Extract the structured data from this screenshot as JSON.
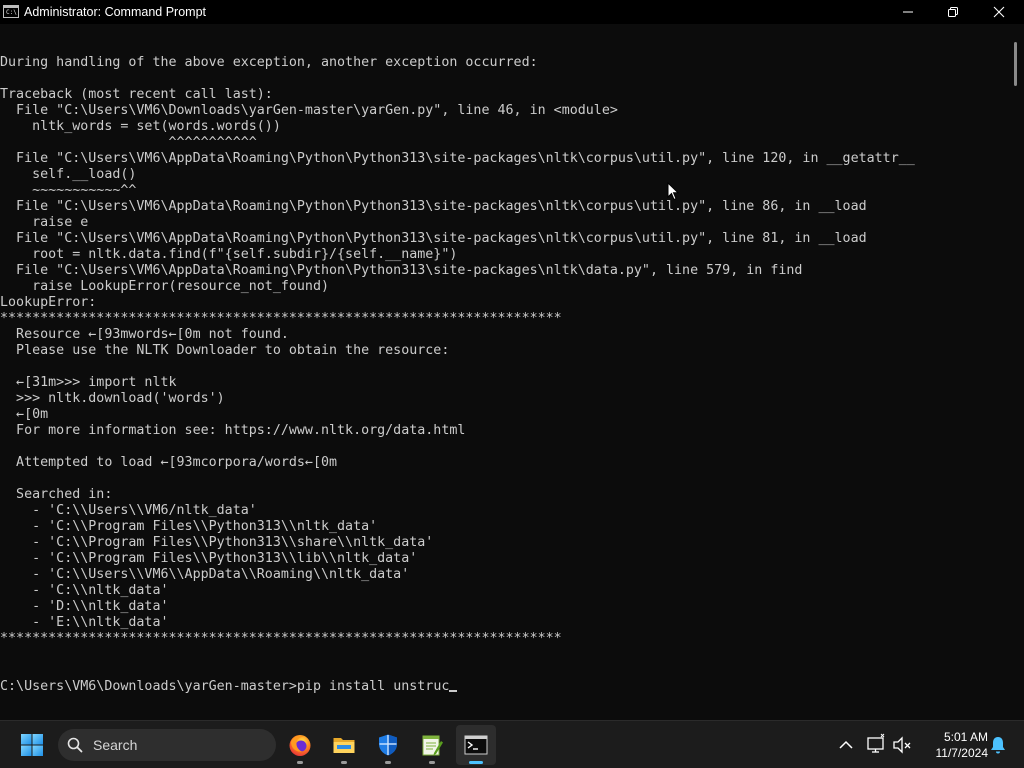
{
  "window": {
    "title": "Administrator: Command Prompt",
    "icon_text": "C:\\"
  },
  "console": {
    "lines": [
      "During handling of the above exception, another exception occurred:",
      "",
      "Traceback (most recent call last):",
      "  File \"C:\\Users\\VM6\\Downloads\\yarGen-master\\yarGen.py\", line 46, in <module>",
      "    nltk_words = set(words.words())",
      "                     ^^^^^^^^^^^",
      "  File \"C:\\Users\\VM6\\AppData\\Roaming\\Python\\Python313\\site-packages\\nltk\\corpus\\util.py\", line 120, in __getattr__",
      "    self.__load()",
      "    ~~~~~~~~~~~^^",
      "  File \"C:\\Users\\VM6\\AppData\\Roaming\\Python\\Python313\\site-packages\\nltk\\corpus\\util.py\", line 86, in __load",
      "    raise e",
      "  File \"C:\\Users\\VM6\\AppData\\Roaming\\Python\\Python313\\site-packages\\nltk\\corpus\\util.py\", line 81, in __load",
      "    root = nltk.data.find(f\"{self.subdir}/{self.__name}\")",
      "  File \"C:\\Users\\VM6\\AppData\\Roaming\\Python\\Python313\\site-packages\\nltk\\data.py\", line 579, in find",
      "    raise LookupError(resource_not_found)",
      "LookupError:",
      "**********************************************************************",
      "  Resource ←[93mwords←[0m not found.",
      "  Please use the NLTK Downloader to obtain the resource:",
      "",
      "  ←[31m>>> import nltk",
      "  >>> nltk.download('words')",
      "  ←[0m",
      "  For more information see: https://www.nltk.org/data.html",
      "",
      "  Attempted to load ←[93mcorpora/words←[0m",
      "",
      "  Searched in:",
      "    - 'C:\\\\Users\\\\VM6/nltk_data'",
      "    - 'C:\\\\Program Files\\\\Python313\\\\nltk_data'",
      "    - 'C:\\\\Program Files\\\\Python313\\\\share\\\\nltk_data'",
      "    - 'C:\\\\Program Files\\\\Python313\\\\lib\\\\nltk_data'",
      "    - 'C:\\\\Users\\\\VM6\\\\AppData\\\\Roaming\\\\nltk_data'",
      "    - 'C:\\\\nltk_data'",
      "    - 'D:\\\\nltk_data'",
      "    - 'E:\\\\nltk_data'",
      "**********************************************************************"
    ],
    "prompt": "C:\\Users\\VM6\\Downloads\\yarGen-master>",
    "input": "pip install unstruc"
  },
  "taskbar": {
    "search_label": "Search",
    "apps": [
      {
        "name": "start",
        "icon": "windows-logo-icon"
      },
      {
        "name": "firefox",
        "icon": "firefox-icon"
      },
      {
        "name": "file-explorer",
        "icon": "folder-icon"
      },
      {
        "name": "windows-security",
        "icon": "shield-icon"
      },
      {
        "name": "notepad-plus-plus",
        "icon": "notepad-icon"
      },
      {
        "name": "command-prompt",
        "icon": "terminal-icon",
        "active": true
      }
    ],
    "tray": {
      "time": "5:01 AM",
      "date": "11/7/2024"
    }
  },
  "colors": {
    "console_bg": "#0c0c0c",
    "console_fg": "#cccccc",
    "taskbar_bg": "#1c1c1c",
    "accent": "#4cc2ff"
  }
}
